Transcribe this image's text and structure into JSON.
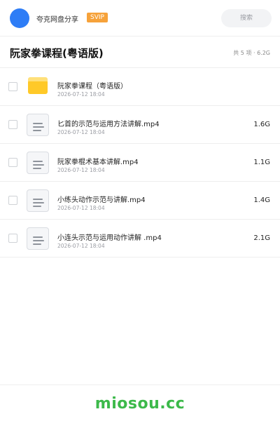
{
  "app": {
    "name": "夸克网盘分享",
    "badge": "SVIP"
  },
  "search": {
    "placeholder": "搜索"
  },
  "header": {
    "title": "阮家拳课程(粤语版)",
    "summary": "共 5 项 · 6.2G"
  },
  "files": [
    {
      "name": "阮家拳课程（粤语版）",
      "date": "2026-07-12 18:04",
      "size": "",
      "type": "folder"
    },
    {
      "name": "匕首的示范与运用方法讲解.mp4",
      "date": "2026-07-12 18:04",
      "size": "1.6G",
      "type": "video"
    },
    {
      "name": "阮家拳棍术基本讲解.mp4",
      "date": "2026-07-12 18:04",
      "size": "1.1G",
      "type": "video"
    },
    {
      "name": "小练头动作示范与讲解.mp4",
      "date": "2026-07-12 18:04",
      "size": "1.4G",
      "type": "video"
    },
    {
      "name": "小连头示范与运用动作讲解 .mp4",
      "date": "2026-07-12 18:04",
      "size": "2.1G",
      "type": "video"
    }
  ],
  "footer": {
    "watermark": "miosou.cc",
    "watermark_color": "#3cb94a"
  },
  "colors": {
    "accent": "#2e7df6",
    "badge": "#f6a23a",
    "folder": "#ffc928"
  }
}
